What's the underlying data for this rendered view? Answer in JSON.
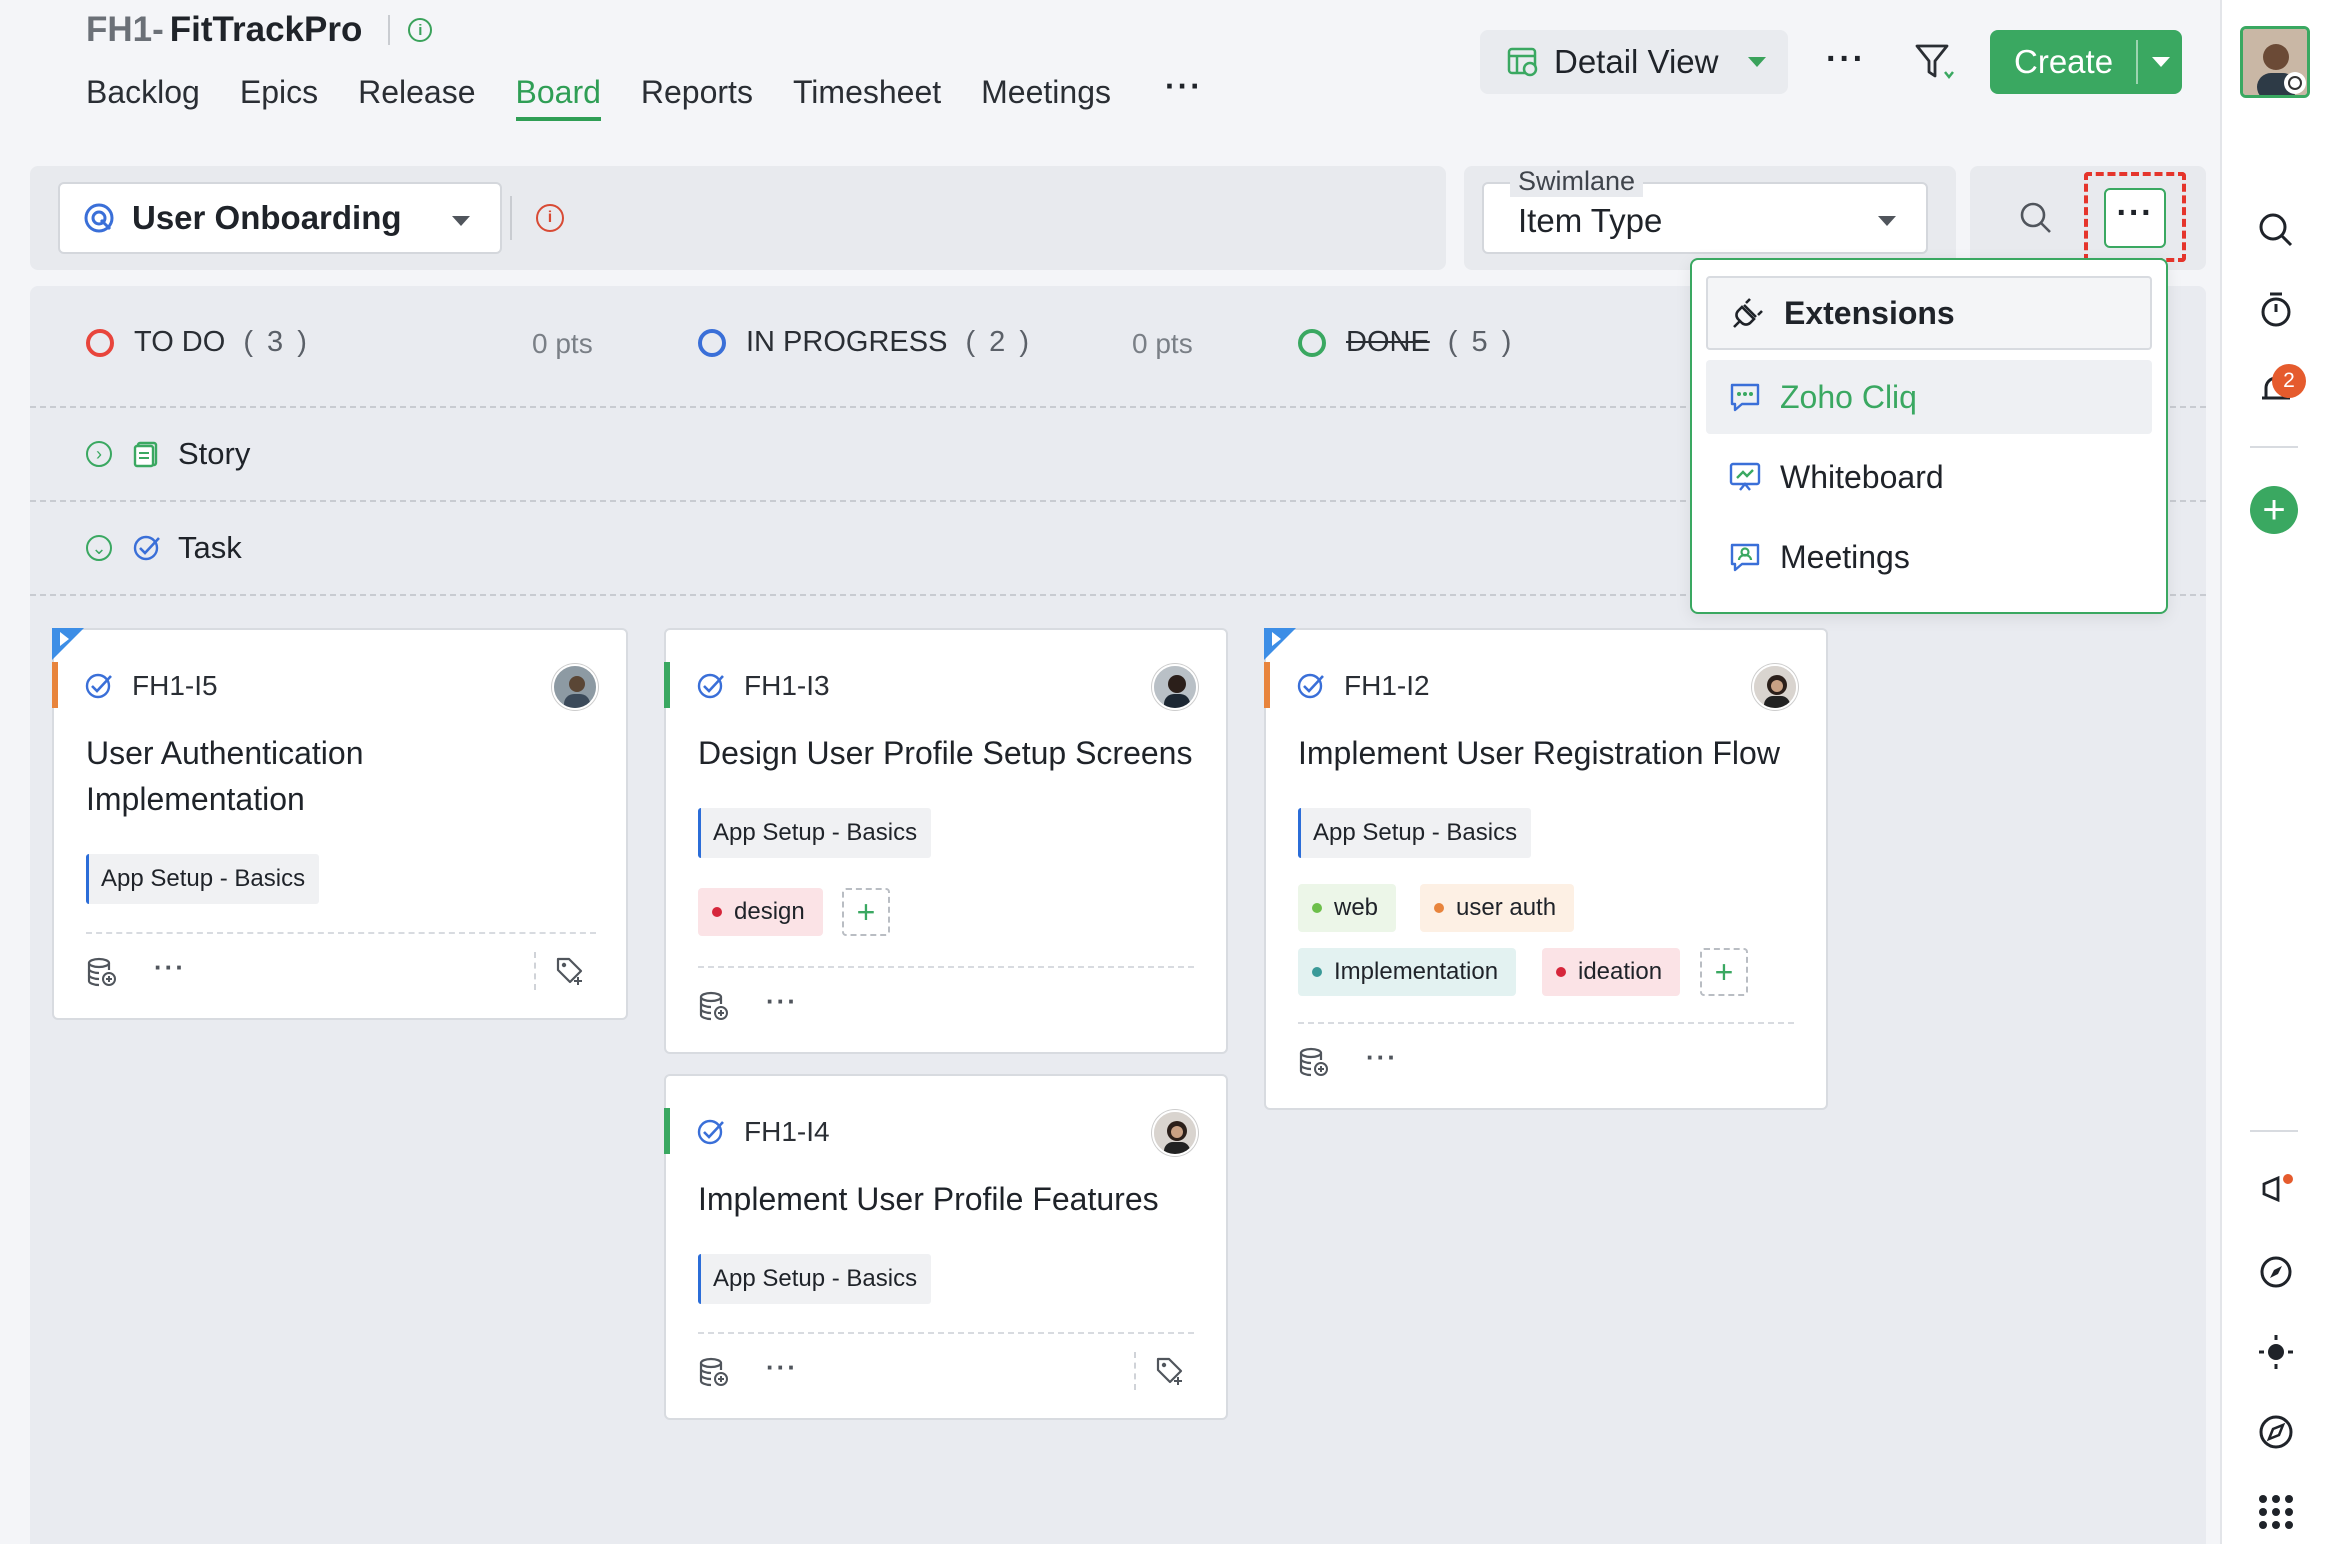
{
  "project": {
    "key": "FH1-",
    "name": "FitTrackPro"
  },
  "nav": {
    "tabs": [
      {
        "label": "Backlog"
      },
      {
        "label": "Epics"
      },
      {
        "label": "Release"
      },
      {
        "label": "Board",
        "active": true
      },
      {
        "label": "Reports"
      },
      {
        "label": "Timesheet"
      },
      {
        "label": "Meetings"
      }
    ],
    "more": "···"
  },
  "header": {
    "view_label": "Detail View",
    "more": "···",
    "create_label": "Create"
  },
  "toolbar": {
    "sprint": "User Onboarding",
    "swimlane_legend": "Swimlane",
    "swimlane_value": "Item Type",
    "more": "···"
  },
  "columns": [
    {
      "status": "TO DO",
      "count": "( 3 )",
      "points": "0 pts",
      "color": "#e8453c"
    },
    {
      "status": "IN PROGRESS",
      "count": "( 2 )",
      "points": "0 pts",
      "color": "#3a6fd8"
    },
    {
      "status": "DONE",
      "count": "( 5 )",
      "color": "#3aa861"
    }
  ],
  "lanes": [
    {
      "label": "Story"
    },
    {
      "label": "Task"
    }
  ],
  "cards": [
    {
      "id": "FH1-I5",
      "title": "User Authentication Implementation",
      "epic": "App Setup - Basics",
      "priority_color": "#e8843c"
    },
    {
      "id": "FH1-I3",
      "title": "Design User Profile Setup Screens",
      "epic": "App Setup - Basics",
      "priority_color": "#3aa861",
      "tags": [
        {
          "label": "design",
          "color": "#d6263b",
          "bg": "#fbe3e6"
        }
      ]
    },
    {
      "id": "FH1-I2",
      "title": "Implement User Registration Flow",
      "epic": "App Setup - Basics",
      "priority_color": "#e8843c",
      "tags": [
        {
          "label": "web",
          "color": "#6cbf4a",
          "bg": "#ecf6e8"
        },
        {
          "label": "user auth",
          "color": "#e8843c",
          "bg": "#fdf0e4"
        },
        {
          "label": "Implementation",
          "color": "#3a9a98",
          "bg": "#e3f2f1"
        },
        {
          "label": "ideation",
          "color": "#d6263b",
          "bg": "#fbe3e6"
        }
      ]
    },
    {
      "id": "FH1-I4",
      "title": "Implement User Profile Features",
      "epic": "App Setup - Basics",
      "priority_color": "#3aa861"
    }
  ],
  "card_more": "···",
  "menu": {
    "items": [
      {
        "label": "Extensions"
      },
      {
        "label": "Zoho Cliq"
      },
      {
        "label": "Whiteboard"
      },
      {
        "label": "Meetings"
      }
    ]
  },
  "rail": {
    "notification_count": "2"
  }
}
